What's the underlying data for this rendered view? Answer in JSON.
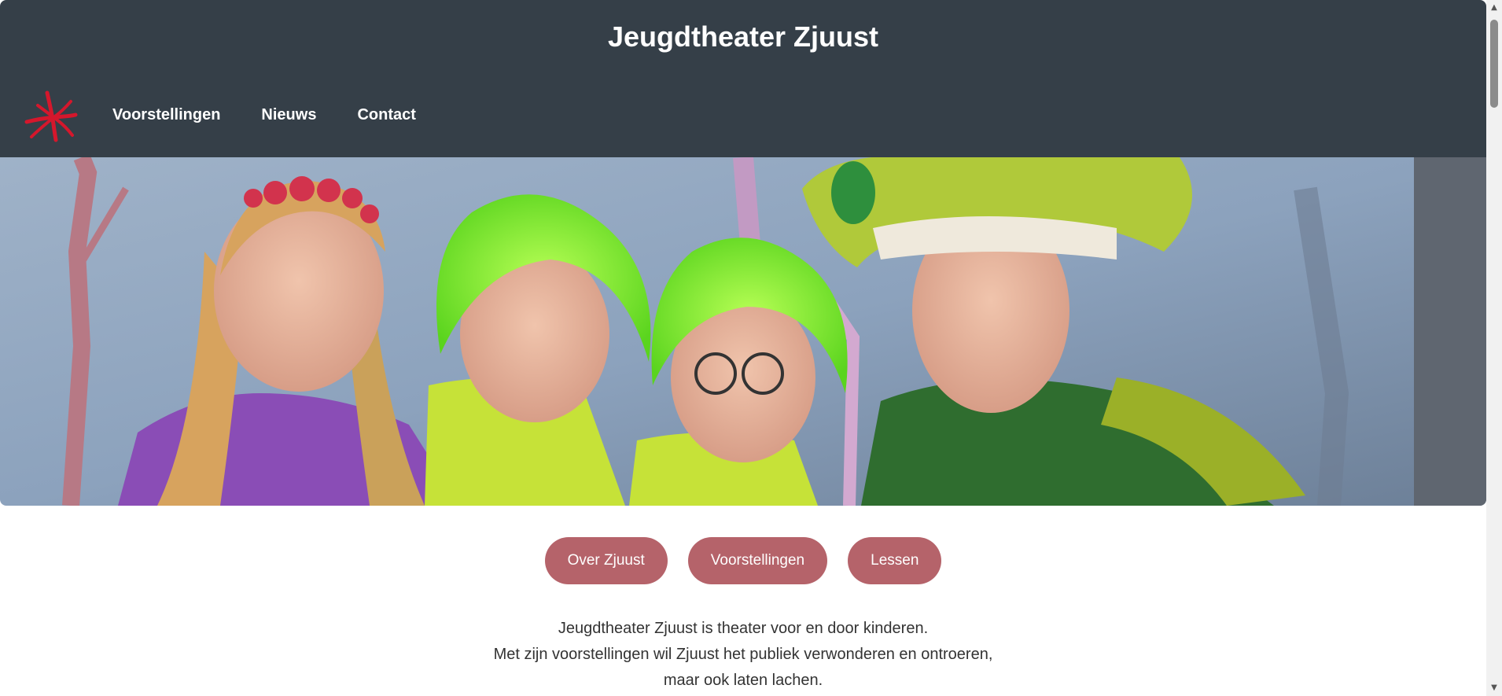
{
  "site": {
    "title": "Jeugdtheater Zjuust",
    "logo_icon": "zjuust-asterisk-logo",
    "colors": {
      "header_bg": "#353f48",
      "accent": "#b5636a",
      "logo": "#d5172c"
    }
  },
  "nav": {
    "items": [
      {
        "label": "Voorstellingen"
      },
      {
        "label": "Nieuws"
      },
      {
        "label": "Contact"
      }
    ]
  },
  "hero": {
    "image_icon": "hero-photo"
  },
  "buttons": [
    {
      "label": "Over Zjuust"
    },
    {
      "label": "Voorstellingen"
    },
    {
      "label": "Lessen"
    }
  ],
  "intro": {
    "lines": [
      "Jeugdtheater Zjuust is theater voor en door kinderen.",
      "Met zijn voorstellingen wil Zjuust het publiek verwonderen en ontroeren,",
      "maar ook laten lachen."
    ]
  },
  "scrollbar": {
    "up_icon": "scroll-up-arrow-icon",
    "down_icon": "scroll-down-arrow-icon"
  }
}
